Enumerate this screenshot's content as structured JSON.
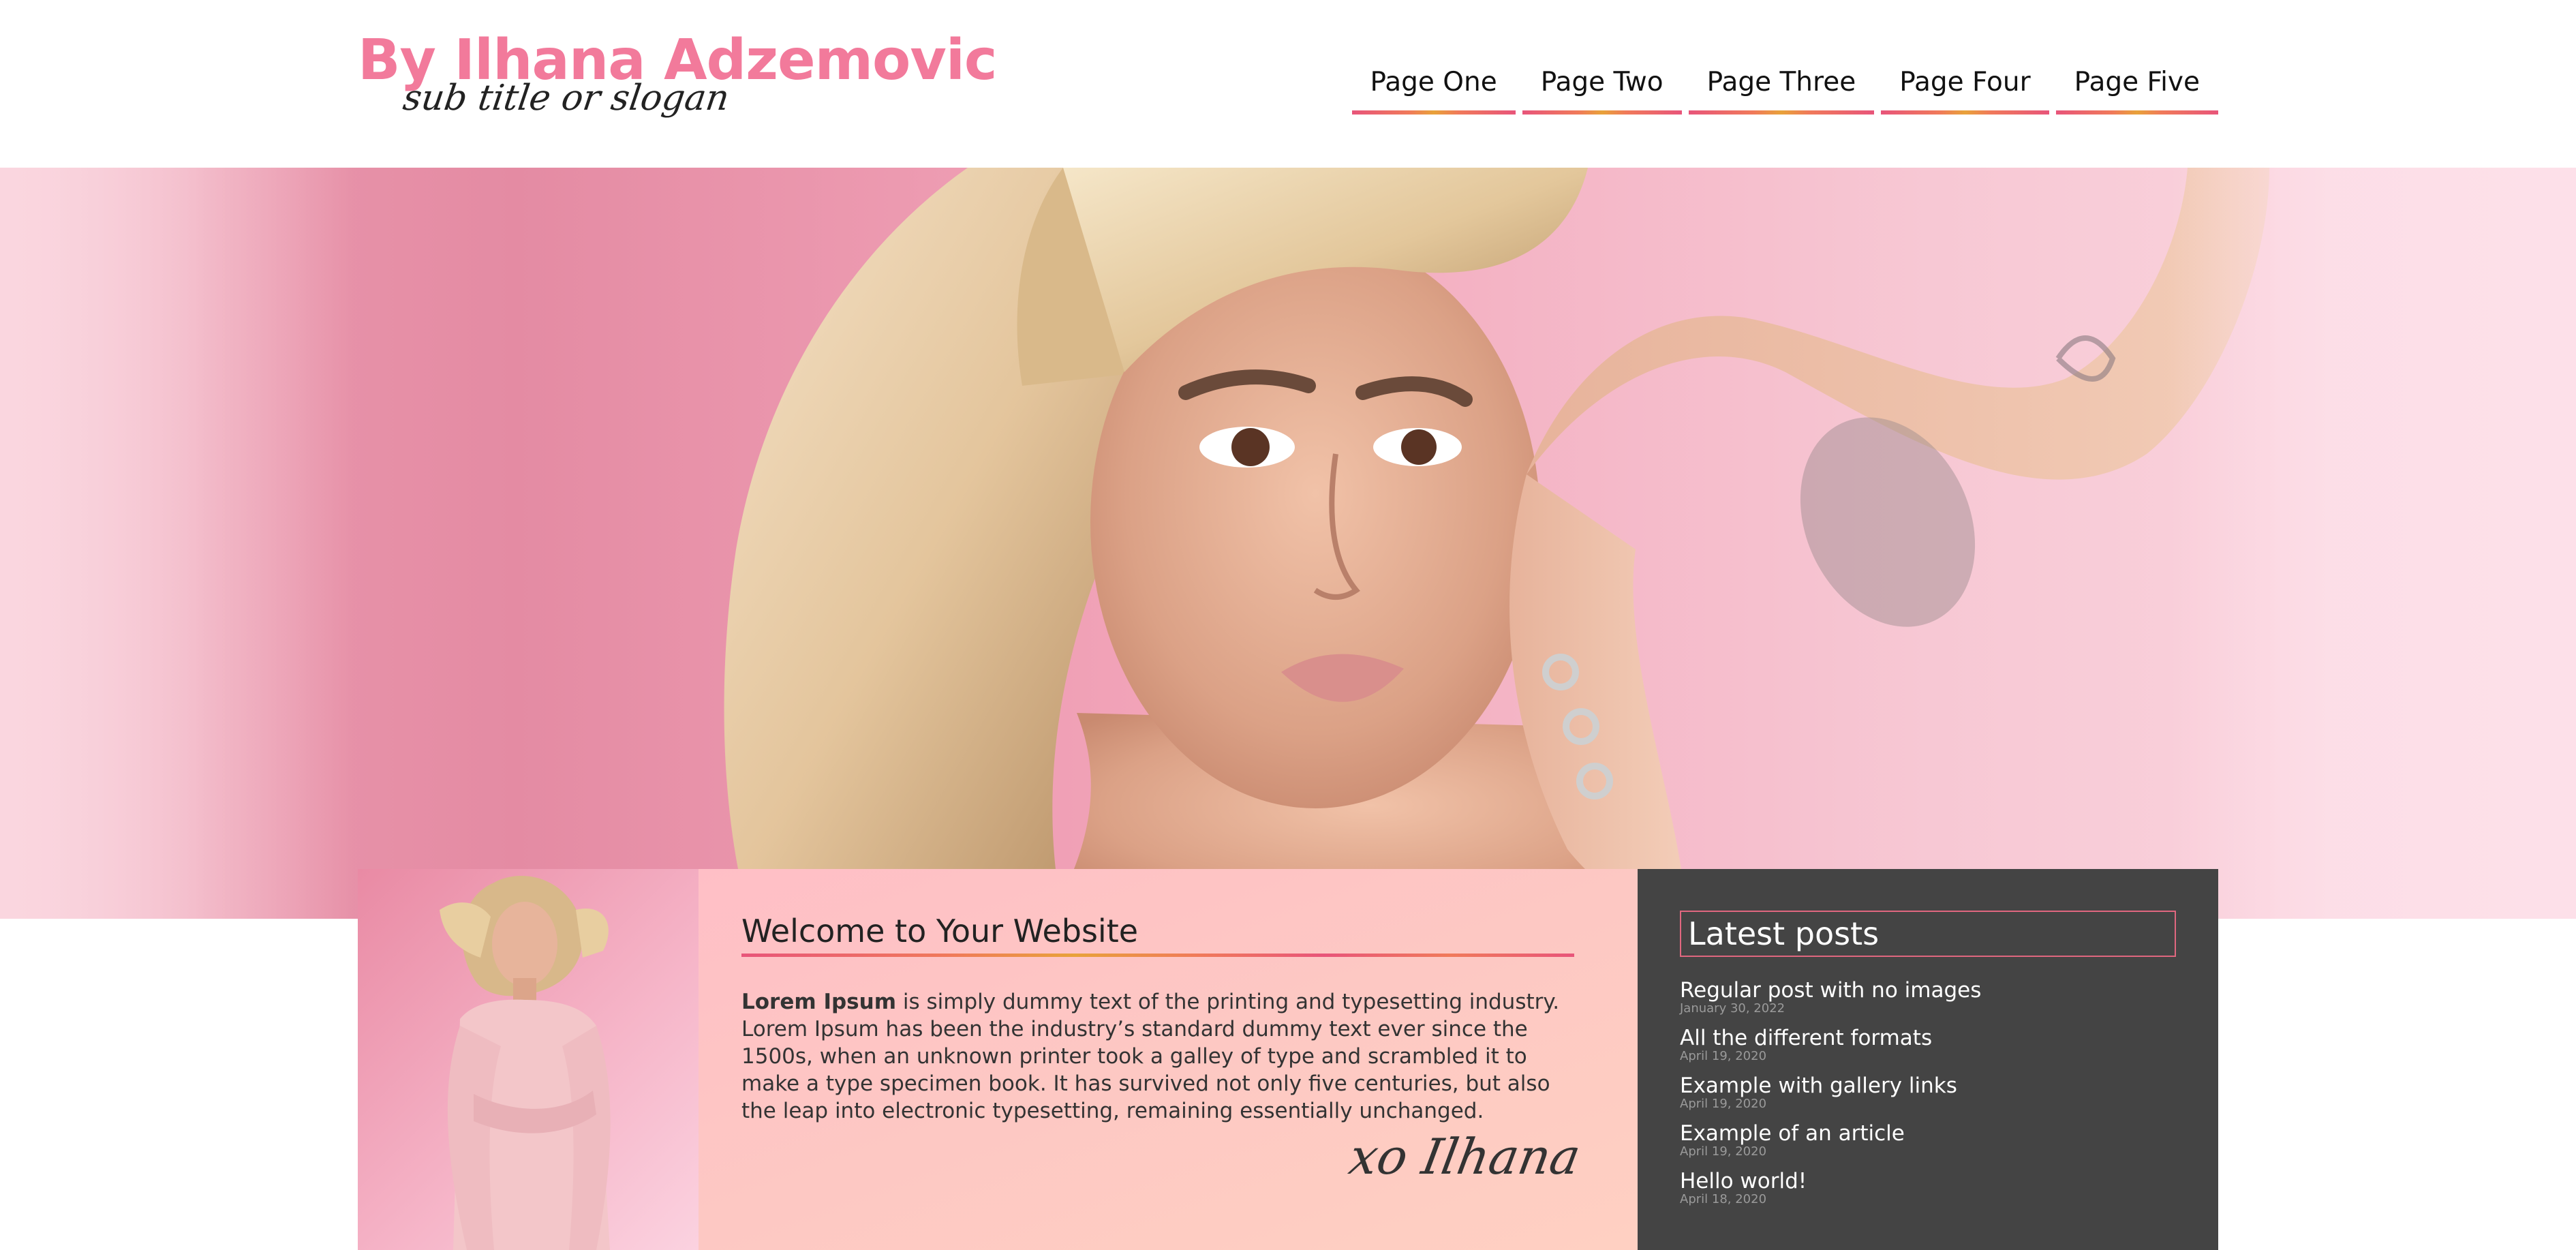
{
  "header": {
    "site_title": "By Ilhana Adzemovic",
    "slogan": "sub title or slogan"
  },
  "nav": {
    "items": [
      {
        "label": "Page One"
      },
      {
        "label": "Page Two"
      },
      {
        "label": "Page Three"
      },
      {
        "label": "Page Four"
      },
      {
        "label": "Page Five"
      }
    ]
  },
  "welcome": {
    "title": "Welcome to Your Website",
    "body_bold": "Lorem Ipsum",
    "body_rest": " is simply dummy text of the printing and typesetting industry. Lorem Ipsum has been the industry’s standard dummy text ever since the 1500s, when an unknown printer took a galley of type and scrambled it to make a type specimen book. It has survived not only five centuries, but also the leap into electronic typesetting, remaining essentially unchanged.",
    "signature": "xo Ilhana"
  },
  "latest_posts": {
    "title": "Latest posts",
    "items": [
      {
        "title": "Regular post with no images",
        "date": "January 30, 2022"
      },
      {
        "title": "All the different formats",
        "date": "April 19, 2020"
      },
      {
        "title": "Example with gallery links",
        "date": "April 19, 2020"
      },
      {
        "title": "Example of an article",
        "date": "April 19, 2020"
      },
      {
        "title": "Hello world!",
        "date": "April 18, 2020"
      }
    ]
  },
  "colors": {
    "brand_pink": "#f27a9b",
    "sidebar_bg": "#444444",
    "accent_border": "#e0677f"
  }
}
